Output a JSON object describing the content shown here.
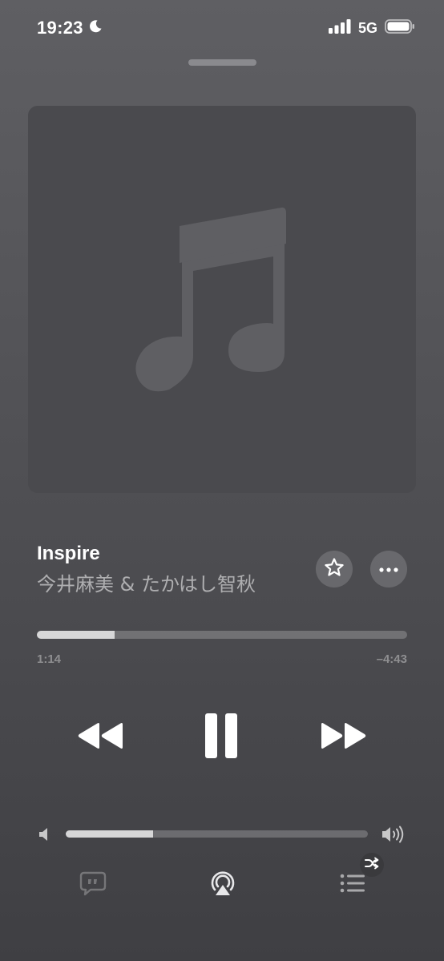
{
  "status_bar": {
    "time": "19:23",
    "network": "5G",
    "icons": [
      "moon-icon",
      "signal-icon",
      "battery-icon"
    ]
  },
  "artwork": {
    "icon": "music-note-icon",
    "color": "#5f5f63"
  },
  "track": {
    "title": "Inspire",
    "artist": "今井麻美 & たかはし智秋"
  },
  "actions": {
    "favorite_icon": "star-icon",
    "more_icon": "ellipsis-icon"
  },
  "playback": {
    "elapsed": "1:14",
    "remaining": "–4:43",
    "progress_fraction": 0.21
  },
  "controls": {
    "previous_icon": "rewind-icon",
    "play_pause_icon": "pause-icon",
    "next_icon": "fast-forward-icon"
  },
  "volume": {
    "level_fraction": 0.29,
    "min_icon": "speaker-low-icon",
    "max_icon": "speaker-high-icon"
  },
  "bottom_bar": {
    "lyrics_icon": "lyrics-icon",
    "airplay_icon": "airplay-icon",
    "queue_icon": "queue-list-icon",
    "shuffle_badge_icon": "shuffle-icon"
  },
  "colors": {
    "background_top": "#5f5f63",
    "background_bottom": "#3f3f43",
    "artwork_bg": "#4a4a4e",
    "text_primary": "#ffffff"
  }
}
